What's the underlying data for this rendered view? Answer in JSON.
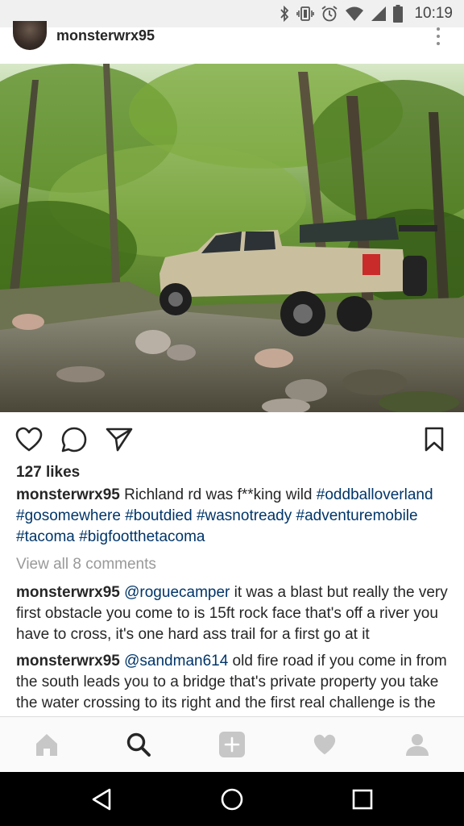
{
  "status_bar": {
    "time": "10:19",
    "icons": [
      "bluetooth-icon",
      "vibrate-icon",
      "alarm-icon",
      "wifi-icon",
      "signal-icon",
      "battery-icon"
    ]
  },
  "post": {
    "username": "monsterwrx95",
    "likes": "127 likes",
    "caption": {
      "username": "monsterwrx95",
      "text": " Richland rd was f**king wild ",
      "hashtags": [
        "#oddballoverland",
        "#gosomewhere",
        "#boutdied",
        "#wasnotready",
        "#adventuremobile",
        "#tacoma",
        "#bigfootthetacoma"
      ]
    },
    "view_comments": "View all 8 comments",
    "comments": [
      {
        "username": "monsterwrx95",
        "mention": "@roguecamper",
        "text": " it was a blast but really the very first obstacle you come to is 15ft rock face that's off a river you have to cross, it's one hard ass trail for a first go at it"
      },
      {
        "username": "monsterwrx95",
        "mention": "@sandman614",
        "text": " old fire road if you come in from the south leads you to a bridge that's private property you take the water crossing to its right and the first real challenge is the rock face you climb to fo to a private"
      }
    ]
  },
  "actions": {
    "icons": [
      "heart-icon",
      "comment-icon",
      "share-icon",
      "bookmark-icon"
    ]
  },
  "tab_bar": {
    "icons": [
      "home-icon",
      "search-icon",
      "add-post-icon",
      "activity-heart-icon",
      "profile-icon"
    ]
  },
  "nav_bar": {
    "icons": [
      "back-icon",
      "home-circle-icon",
      "recents-icon"
    ]
  },
  "colors": {
    "link": "#003569",
    "muted": "#999999",
    "text": "#262626",
    "tab_inactive": "#c7c7c7",
    "tab_active": "#262626"
  }
}
